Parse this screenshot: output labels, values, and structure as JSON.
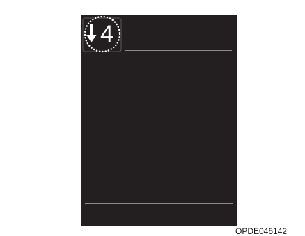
{
  "display": {
    "gear_value": "4",
    "shift_direction": "down"
  },
  "icons": {
    "shift_arrow": "arrow-down-icon",
    "highlight_ring": "dotted-circle-highlight"
  },
  "colors": {
    "panel_background": "#231f20",
    "divider": "#8a8a8a",
    "indicator": "#ffffff"
  },
  "image_code": "OPDE046142"
}
